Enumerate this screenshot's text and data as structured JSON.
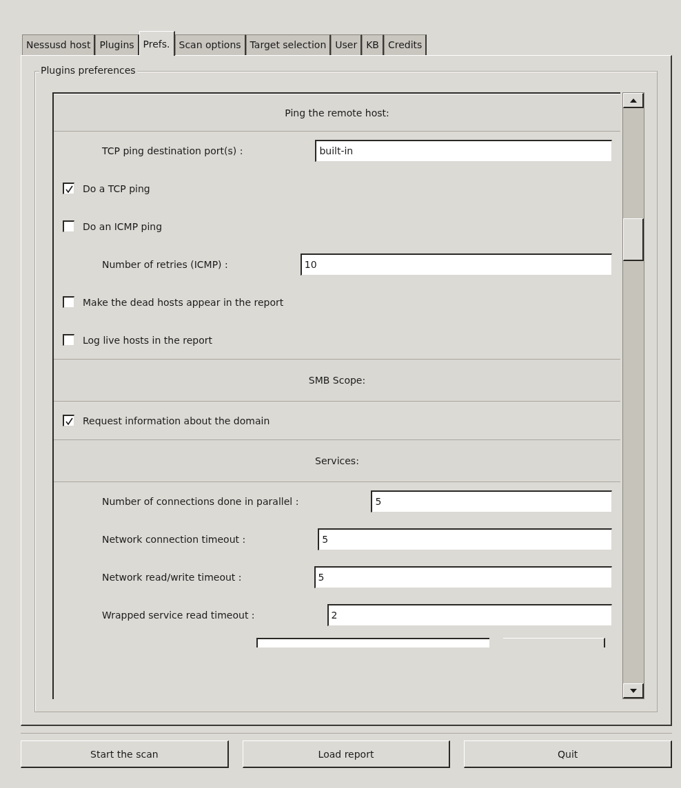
{
  "tabs": [
    {
      "label": "Nessusd host",
      "selected": false
    },
    {
      "label": "Plugins",
      "selected": false
    },
    {
      "label": "Prefs.",
      "selected": true
    },
    {
      "label": "Scan options",
      "selected": false
    },
    {
      "label": "Target selection",
      "selected": false
    },
    {
      "label": "User",
      "selected": false
    },
    {
      "label": "KB",
      "selected": false
    },
    {
      "label": "Credits",
      "selected": false
    }
  ],
  "group": {
    "title": "Plugins preferences"
  },
  "preferences": [
    {
      "kind": "header",
      "label": "Ping the remote host:"
    },
    {
      "kind": "entry",
      "label": "TCP ping destination port(s) :",
      "value": "built-in"
    },
    {
      "kind": "check",
      "label": "Do a TCP ping",
      "checked": true
    },
    {
      "kind": "check",
      "label": "Do an ICMP ping",
      "checked": false
    },
    {
      "kind": "entry",
      "label": "Number of retries (ICMP) :",
      "value": "10"
    },
    {
      "kind": "check",
      "label": "Make the dead hosts appear in the report",
      "checked": false
    },
    {
      "kind": "check",
      "label": "Log live hosts in the report",
      "checked": false
    },
    {
      "kind": "header",
      "label": "SMB Scope:"
    },
    {
      "kind": "check",
      "label": "Request information about the domain",
      "checked": true
    },
    {
      "kind": "header",
      "label": "Services:"
    },
    {
      "kind": "entry",
      "label": "Number of connections done in parallel :",
      "value": "5"
    },
    {
      "kind": "entry",
      "label": "Network connection timeout :",
      "value": "5"
    },
    {
      "kind": "entry",
      "label": "Network read/write timeout :",
      "value": "5"
    },
    {
      "kind": "entry",
      "label": "Wrapped service read timeout :",
      "value": "2"
    },
    {
      "kind": "clipped"
    }
  ],
  "buttons": [
    "Start the scan",
    "Load report",
    "Quit"
  ]
}
